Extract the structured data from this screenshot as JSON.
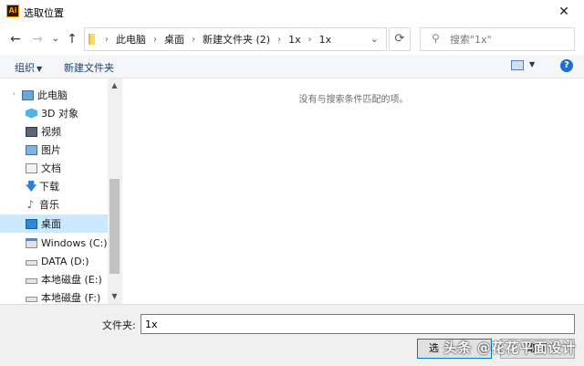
{
  "window": {
    "title": "选取位置",
    "app_icon_text": "Ai",
    "close_glyph": "✕"
  },
  "nav": {
    "back_glyph": "←",
    "forward_glyph": "→",
    "recent_glyph": "⌄",
    "up_glyph": "↑",
    "breadcrumb": [
      "此电脑",
      "桌面",
      "新建文件夹 (2)",
      "1x",
      "1x"
    ],
    "breadcrumb_separator": "›",
    "address_dropdown_glyph": "⌄",
    "refresh_glyph": "⟳",
    "search_placeholder": "搜索\"1x\"",
    "search_glyph": "⚲"
  },
  "commands": {
    "organize": "组织",
    "organize_caret": "▼",
    "new_folder": "新建文件夹",
    "view_caret": "▼",
    "help": "?"
  },
  "sidebar": {
    "items": [
      {
        "label": "此电脑",
        "icon": "computer-icon",
        "expander": "›"
      },
      {
        "label": "3D 对象",
        "icon": "3d-objects-icon"
      },
      {
        "label": "视频",
        "icon": "video-icon"
      },
      {
        "label": "图片",
        "icon": "pictures-icon"
      },
      {
        "label": "文档",
        "icon": "documents-icon"
      },
      {
        "label": "下载",
        "icon": "download-icon",
        "glyph": "🡇"
      },
      {
        "label": "音乐",
        "icon": "music-icon",
        "glyph": "♪"
      },
      {
        "label": "桌面",
        "icon": "desktop-icon",
        "selected": true
      },
      {
        "label": "Windows (C:)",
        "icon": "windows-drive-icon"
      },
      {
        "label": "DATA (D:)",
        "icon": "drive-icon"
      },
      {
        "label": "本地磁盘 (E:)",
        "icon": "drive-icon"
      },
      {
        "label": "本地磁盘 (F:)",
        "icon": "drive-icon"
      }
    ],
    "scroll_up_glyph": "▲",
    "scroll_down_glyph": "▼"
  },
  "main": {
    "empty_message": "没有与搜索条件匹配的项。"
  },
  "footer": {
    "folder_label": "文件夹:",
    "folder_value": "1x",
    "select_button": "选",
    "cancel_button": "取消"
  },
  "watermark": "头条 @花花平面设计",
  "colors": {
    "selected_bg": "#cce8ff",
    "command_text": "#1a3f6f",
    "accent_border": "#0078d7",
    "app_icon_orange": "#ff9a00"
  }
}
